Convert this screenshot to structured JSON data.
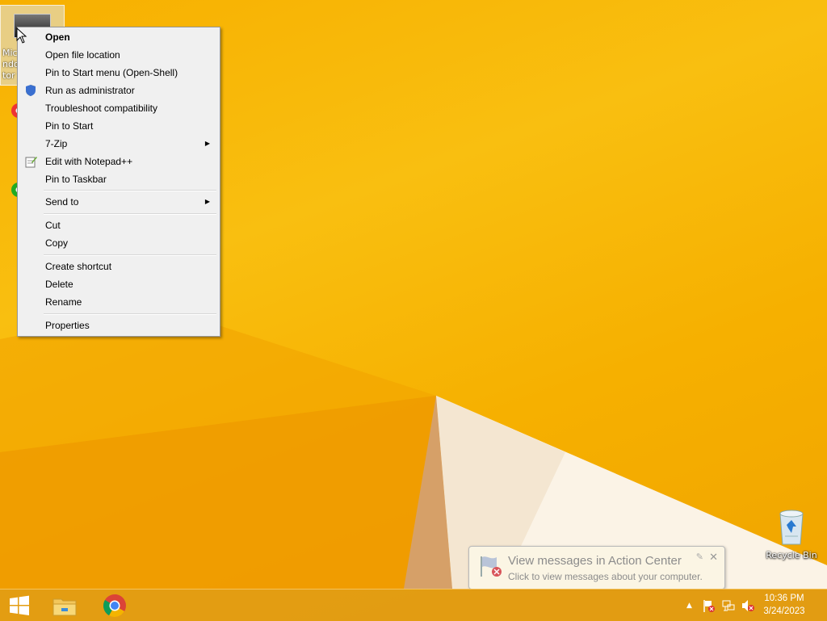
{
  "desktop": {
    "selected_icon_label": "Mic\nndo\ntor",
    "recycle_bin_label": "Recycle Bin"
  },
  "context_menu": {
    "items": [
      {
        "label": "Open",
        "bold": true
      },
      {
        "label": "Open file location"
      },
      {
        "label": "Pin to Start menu (Open-Shell)"
      },
      {
        "label": "Run as administrator",
        "icon": "uac-shield-icon"
      },
      {
        "label": "Troubleshoot compatibility"
      },
      {
        "label": "Pin to Start"
      },
      {
        "label": "7-Zip",
        "submenu": true
      },
      {
        "label": "Edit with Notepad++",
        "icon": "notepad-plus-plus-icon"
      },
      {
        "label": "Pin to Taskbar"
      },
      {
        "label": "Send to",
        "submenu": true
      },
      {
        "label": "Cut"
      },
      {
        "label": "Copy"
      },
      {
        "label": "Create shortcut"
      },
      {
        "label": "Delete"
      },
      {
        "label": "Rename"
      },
      {
        "label": "Properties"
      }
    ]
  },
  "notification": {
    "title": "View messages in Action Center",
    "body": "Click to view messages about your computer.",
    "close_glyph": "✕",
    "pin_glyph": "✎"
  },
  "taskbar": {
    "pinned": [
      "start-button",
      "file-explorer",
      "google-chrome"
    ],
    "tray_expand_glyph": "▲",
    "time": "10:36 PM",
    "date": "3/24/2023"
  },
  "colors": {
    "wallpaper": "#f6b400",
    "menu_bg": "#f0f0f0",
    "taskbar": "#e19b14"
  }
}
